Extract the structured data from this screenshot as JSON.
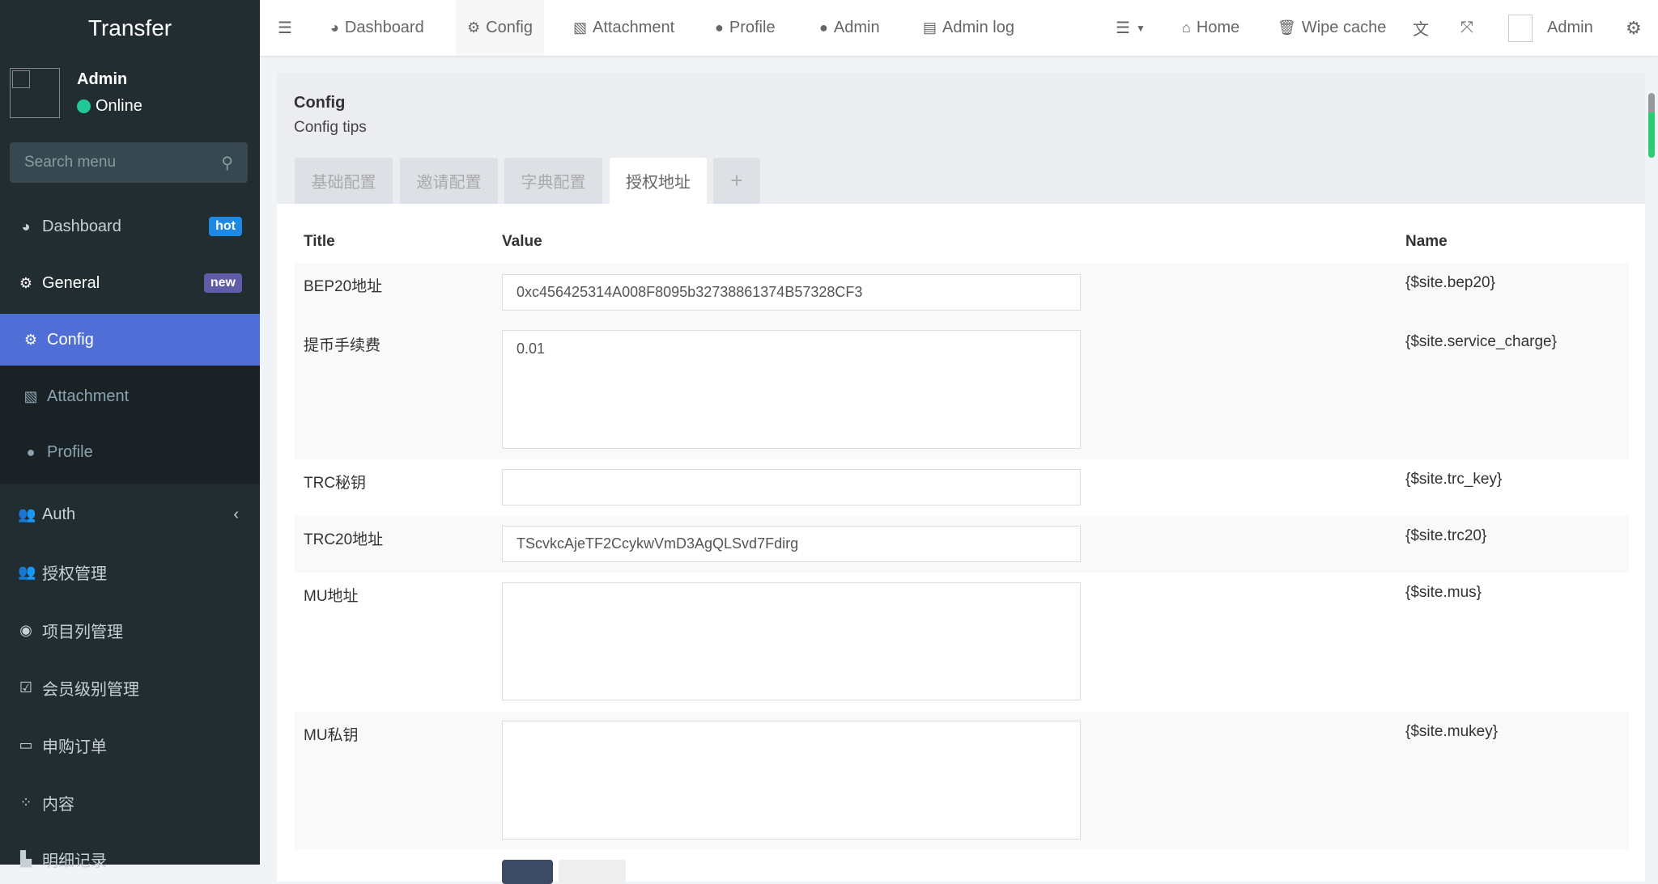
{
  "sidebar": {
    "logo": "Transfer",
    "user": "Admin",
    "status": "Online",
    "search_placeholder": "Search menu",
    "items": [
      {
        "label": "Dashboard",
        "badge": "hot",
        "badge_color": "#1e88e5"
      },
      {
        "label": "General",
        "badge": "new",
        "badge_color": "#605ca8"
      },
      {
        "label": "Config"
      },
      {
        "label": "Attachment"
      },
      {
        "label": "Profile"
      },
      {
        "label": "Auth"
      },
      {
        "label": "授权管理"
      },
      {
        "label": "项目列管理"
      },
      {
        "label": "会员级别管理"
      },
      {
        "label": "申购订单"
      },
      {
        "label": "内容"
      },
      {
        "label": "明细记录"
      }
    ]
  },
  "topnav": {
    "left": [
      "Dashboard",
      "Config",
      "Attachment",
      "Profile",
      "Admin",
      "Admin log"
    ],
    "home": "Home",
    "wipe": "Wipe cache",
    "user": "Admin"
  },
  "panel": {
    "title": "Config",
    "tips": "Config tips",
    "tabs": [
      "基础配置",
      "邀请配置",
      "字典配置",
      "授权地址",
      "+"
    ],
    "headers": {
      "title": "Title",
      "value": "Value",
      "name": "Name"
    },
    "rows": [
      {
        "title": "BEP20地址",
        "value": "0xc456425314A008F8095b32738861374B57328CF3",
        "name": "{$site.bep20}"
      },
      {
        "title": "提币手续费",
        "value": "0.01",
        "name": "{$site.service_charge}"
      },
      {
        "title": "TRC秘钥",
        "value": "",
        "name": "{$site.trc_key}"
      },
      {
        "title": "TRC20地址",
        "value": "TScvkcAjeTF2CcykwVmD3AgQLSvd7Fdirg",
        "name": "{$site.trc20}"
      },
      {
        "title": "MU地址",
        "value": "",
        "name": "{$site.mus}"
      },
      {
        "title": "MU私钥",
        "value": "",
        "name": "{$site.mukey}"
      }
    ]
  }
}
